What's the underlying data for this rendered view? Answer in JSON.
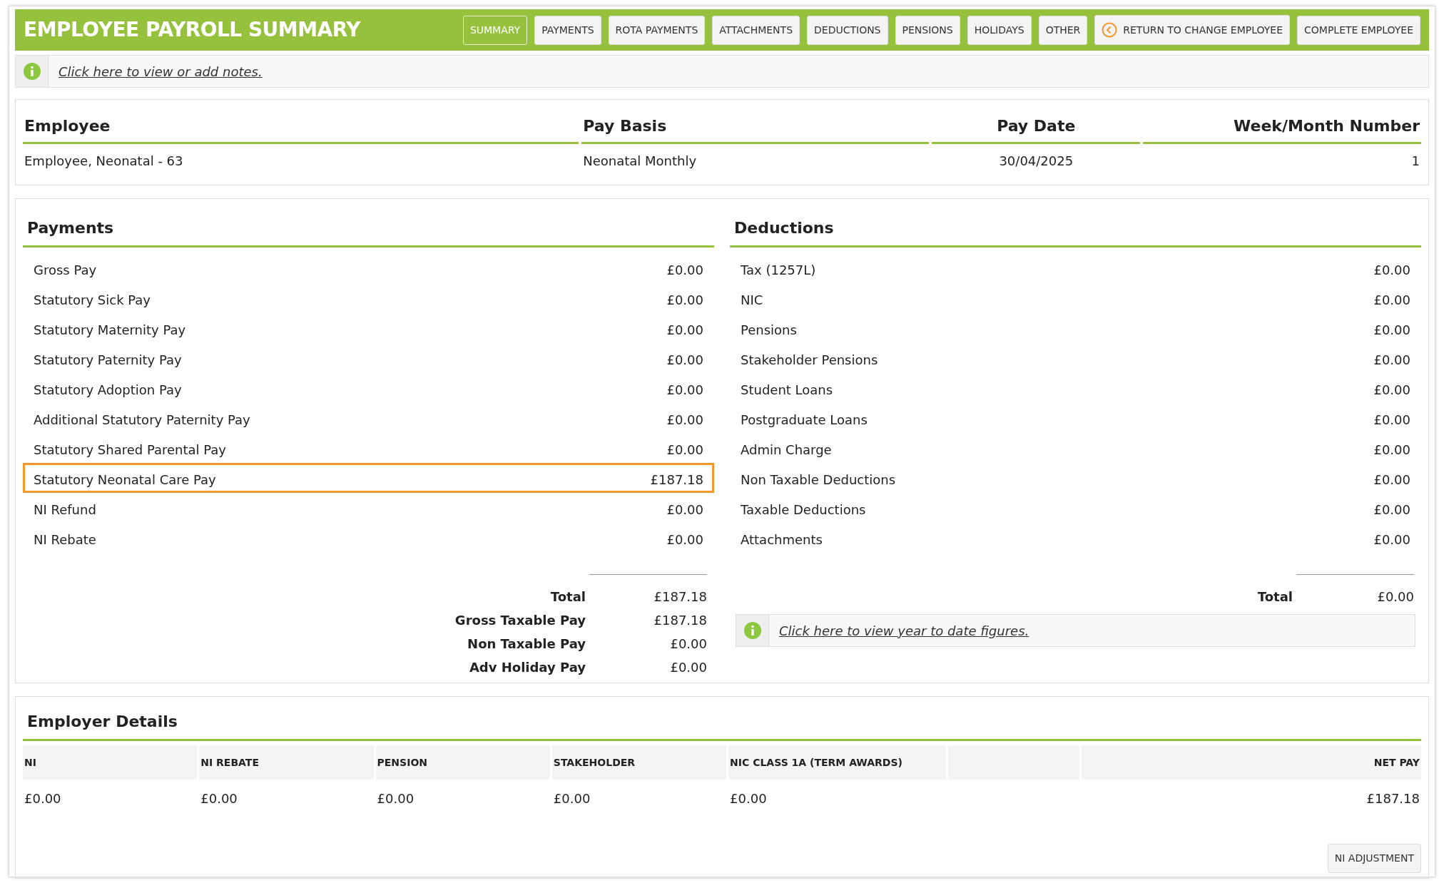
{
  "header": {
    "title": "EMPLOYEE PAYROLL SUMMARY",
    "tabs": [
      {
        "label": "SUMMARY",
        "selected": true
      },
      {
        "label": "PAYMENTS",
        "selected": false
      },
      {
        "label": "ROTA PAYMENTS",
        "selected": false
      },
      {
        "label": "ATTACHMENTS",
        "selected": false
      },
      {
        "label": "DEDUCTIONS",
        "selected": false
      },
      {
        "label": "PENSIONS",
        "selected": false
      },
      {
        "label": "HOLIDAYS",
        "selected": false
      },
      {
        "label": "OTHER",
        "selected": false
      }
    ],
    "buttons": [
      {
        "label": "RETURN TO CHANGE EMPLOYEE",
        "kind": "back"
      },
      {
        "label": "COMPLETE EMPLOYEE",
        "kind": "plain"
      }
    ]
  },
  "notes_link": "Click here to view or add notes.",
  "employee_table": {
    "columns": [
      "Employee",
      "Pay Basis",
      "Pay Date",
      "Week/Month Number"
    ],
    "row": [
      "Employee, Neonatal - 63",
      "Neonatal Monthly",
      "30/04/2025",
      "1"
    ]
  },
  "payments": {
    "title": "Payments",
    "items": [
      {
        "label": "Gross Pay",
        "amount": "£0.00",
        "highlighted": false
      },
      {
        "label": "Statutory Sick Pay",
        "amount": "£0.00",
        "highlighted": false
      },
      {
        "label": "Statutory Maternity Pay",
        "amount": "£0.00",
        "highlighted": false
      },
      {
        "label": "Statutory Paternity Pay",
        "amount": "£0.00",
        "highlighted": false
      },
      {
        "label": "Statutory Adoption Pay",
        "amount": "£0.00",
        "highlighted": false
      },
      {
        "label": "Additional Statutory Paternity Pay",
        "amount": "£0.00",
        "highlighted": false
      },
      {
        "label": "Statutory Shared Parental Pay",
        "amount": "£0.00",
        "highlighted": false
      },
      {
        "label": "Statutory Neonatal Care Pay",
        "amount": "£187.18",
        "highlighted": true
      },
      {
        "label": "NI Refund",
        "amount": "£0.00",
        "highlighted": false
      },
      {
        "label": "NI Rebate",
        "amount": "£0.00",
        "highlighted": false
      }
    ],
    "totals": [
      {
        "label": "Total",
        "amount": "£187.18"
      },
      {
        "label": "Gross Taxable Pay",
        "amount": "£187.18"
      },
      {
        "label": "Non Taxable Pay",
        "amount": "£0.00"
      },
      {
        "label": "Adv Holiday Pay",
        "amount": "£0.00"
      }
    ]
  },
  "deductions": {
    "title": "Deductions",
    "items": [
      {
        "label": "Tax (1257L)",
        "amount": "£0.00"
      },
      {
        "label": "NIC",
        "amount": "£0.00"
      },
      {
        "label": "Pensions",
        "amount": "£0.00"
      },
      {
        "label": "Stakeholder Pensions",
        "amount": "£0.00"
      },
      {
        "label": "Student Loans",
        "amount": "£0.00"
      },
      {
        "label": "Postgraduate Loans",
        "amount": "£0.00"
      },
      {
        "label": "Admin Charge",
        "amount": "£0.00"
      },
      {
        "label": "Non Taxable Deductions",
        "amount": "£0.00"
      },
      {
        "label": "Taxable Deductions",
        "amount": "£0.00"
      },
      {
        "label": "Attachments",
        "amount": "£0.00"
      }
    ],
    "totals": [
      {
        "label": "Total",
        "amount": "£0.00"
      }
    ],
    "ytd_link": "Click here to view year to date figures."
  },
  "employer_details": {
    "title": "Employer Details",
    "columns": [
      "NI",
      "NI REBATE",
      "PENSION",
      "STAKEHOLDER",
      "NIC CLASS 1A (TERM AWARDS)",
      "NET PAY"
    ],
    "row": [
      "£0.00",
      "£0.00",
      "£0.00",
      "£0.00",
      "£0.00",
      "£187.18"
    ],
    "button": "NI ADJUSTMENT"
  }
}
